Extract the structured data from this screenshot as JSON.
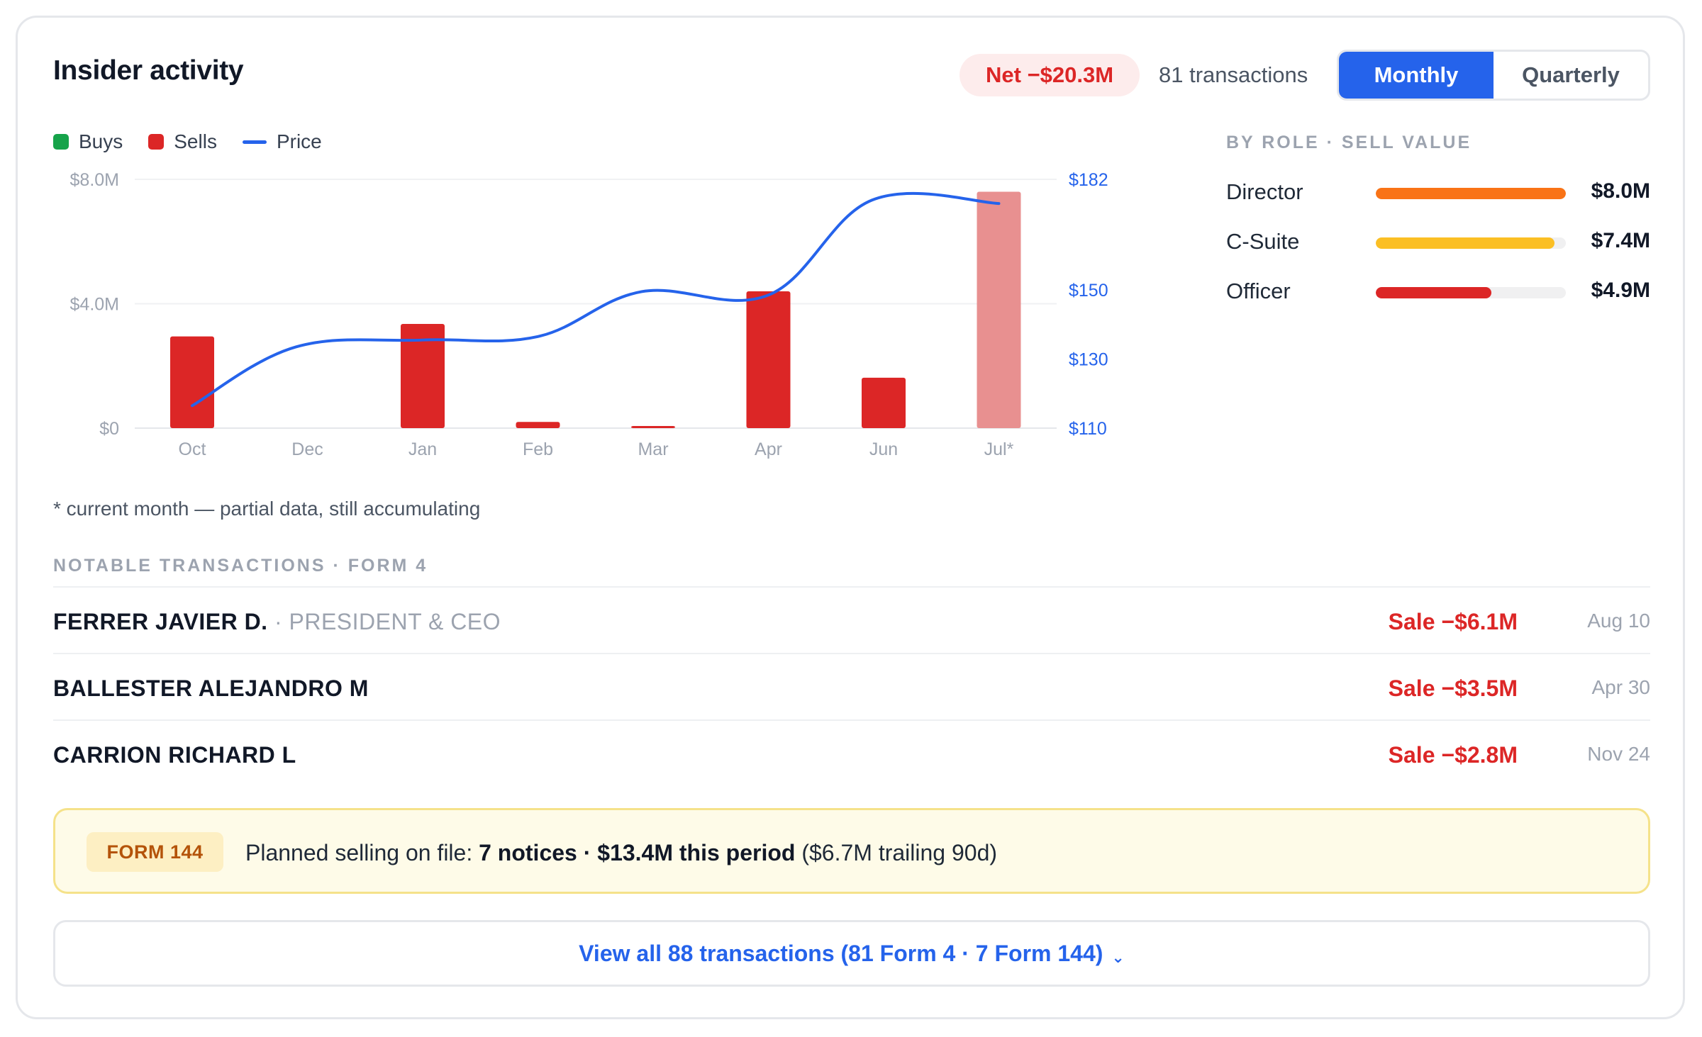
{
  "header": {
    "title": "Insider activity",
    "net_badge": "Net −$20.3M",
    "transactions_count": "81 transactions",
    "toggle": {
      "monthly": "Monthly",
      "quarterly": "Quarterly",
      "selected": "Monthly"
    }
  },
  "legend": {
    "buys": "Buys",
    "sells": "Sells",
    "price": "Price"
  },
  "colors": {
    "buys": "#16a34a",
    "sells": "#dc2626",
    "sells_partial": "#e89090",
    "price": "#2563eb",
    "director": "#f97316",
    "csuite": "#fbbf24",
    "officer": "#dc2626"
  },
  "chart_data": {
    "type": "bar",
    "categories": [
      "Oct",
      "Dec",
      "Jan",
      "Feb",
      "Mar",
      "Apr",
      "Jun",
      "Jul*"
    ],
    "series": [
      {
        "name": "Sells",
        "values": [
          2.95,
          0,
          3.35,
          0.2,
          0.05,
          4.4,
          1.62,
          7.6
        ],
        "partial": [
          false,
          false,
          false,
          false,
          false,
          false,
          false,
          true
        ]
      },
      {
        "name": "Buys",
        "values": [
          0,
          0,
          0,
          0,
          0,
          0,
          0,
          0
        ]
      }
    ],
    "price_line": {
      "name": "Price",
      "x": [
        0,
        0.9,
        2,
        3,
        3.9,
        5,
        5.9,
        7
      ],
      "values": [
        116.5,
        133.5,
        135.5,
        136.5,
        149.5,
        148.5,
        176,
        175
      ]
    },
    "left_axis": {
      "ticks": [
        "$0",
        "$4.0M",
        "$8.0M"
      ],
      "values": [
        0,
        4,
        8
      ],
      "ylim": [
        0,
        8
      ]
    },
    "right_axis": {
      "ticks": [
        "$110",
        "$130",
        "$150",
        "$182"
      ],
      "values": [
        110,
        130,
        150,
        182
      ],
      "ylim": [
        110,
        182
      ]
    },
    "grid": true,
    "legend_position": "top-left"
  },
  "chart_note": "* current month — partial data, still accumulating",
  "roles": {
    "heading": "BY ROLE · SELL VALUE",
    "items": [
      {
        "label": "Director",
        "value": "$8.0M",
        "fraction": 1.0,
        "color": "#f97316"
      },
      {
        "label": "C-Suite",
        "value": "$7.4M",
        "fraction": 0.94,
        "color": "#fbbf24"
      },
      {
        "label": "Officer",
        "value": "$4.9M",
        "fraction": 0.61,
        "color": "#dc2626"
      }
    ]
  },
  "notable": {
    "heading": "NOTABLE TRANSACTIONS · FORM 4",
    "rows": [
      {
        "name": "FERRER JAVIER D.",
        "role": " · PRESIDENT & CEO",
        "amount": "Sale −$6.1M",
        "date": "Aug 10"
      },
      {
        "name": "BALLESTER ALEJANDRO M",
        "role": "",
        "amount": "Sale −$3.5M",
        "date": "Apr 30"
      },
      {
        "name": "CARRION RICHARD L",
        "role": "",
        "amount": "Sale −$2.8M",
        "date": "Nov 24"
      }
    ]
  },
  "form144": {
    "badge": "FORM 144",
    "prefix": "Planned selling on file: ",
    "bold": "7 notices · $13.4M this period",
    "suffix": " ($6.7M trailing 90d)"
  },
  "view_all": {
    "label": "View all 88 transactions (81 Form 4 · 7 Form 144)",
    "chevron": "⌄"
  }
}
